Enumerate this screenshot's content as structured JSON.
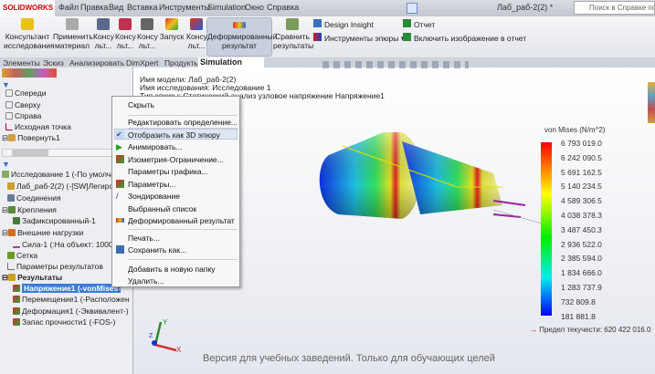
{
  "app": {
    "logo": "SOLIDWORKS",
    "doc_title": "Лаб_раб-2(2) *",
    "search_placeholder": "Поиск в Справке по S"
  },
  "menu": [
    "Файл",
    "Правка",
    "Вид",
    "Вставка",
    "Инструменты",
    "Simulation",
    "Окно",
    "Справка"
  ],
  "ribbon": {
    "buttons": [
      {
        "l1": "Консультант",
        "l2": "исследования"
      },
      {
        "l1": "Применить",
        "l2": "материал"
      },
      {
        "l1": "Консу",
        "l2": "льт..."
      },
      {
        "l1": "Консу",
        "l2": "льт..."
      },
      {
        "l1": "Консу",
        "l2": "льт..."
      },
      {
        "l1": "Запуск",
        "l2": ""
      },
      {
        "l1": "Консу",
        "l2": "льт..."
      },
      {
        "l1": "Деформированный",
        "l2": "результат"
      },
      {
        "l1": "Сравнить",
        "l2": "результаты"
      }
    ],
    "design_insight": "Design Insight",
    "plot_tools": "Инструменты эпюры",
    "report": "Отчет",
    "include_image": "Включить изображение в отчет"
  },
  "tabs": [
    "Элементы",
    "Эскиз",
    "Анализировать",
    "DimXpert",
    "Продукты Office",
    "Simulation"
  ],
  "tree_top": [
    "Спереди",
    "Сверху",
    "Справа",
    "Исходная точка",
    "Повернуть1"
  ],
  "tree": [
    "Исследование 1 (-По умолчанию-)",
    "Лаб_раб-2(2) (-[SW]Легированная сталь-)",
    "Соединения",
    "Крепления",
    "Зафиксированный-1",
    "Внешние нагрузки",
    "Сила-1 (:На объект: 1000 N:)",
    "Сетка",
    "Параметры результатов",
    "Результаты",
    "Напряжение1 (-vonMises-)",
    "Перемещение1 (-Расположение-)",
    "Деформация1 (-Эквивалент-)",
    "Запас прочности1 (-FOS-)"
  ],
  "context_menu": [
    "Скрыть",
    "Редактировать определение...",
    "Отобразить как 3D эпюру",
    "Анимировать...",
    "Изометрия-Ограничение...",
    "Параметры графика...",
    "Параметры...",
    "Зондирование",
    "Выбранный список",
    "Деформированный результат",
    "Печать...",
    "Сохранить как...",
    "Добавить в новую папку",
    "Удалить..."
  ],
  "info": {
    "model": "Имя модели: Лаб_раб-2(2)",
    "study": "Имя исследования: Исследование 1",
    "plot": "Тип эпюры: Статический анализ узловое напряжение Напряжение1"
  },
  "legend": {
    "title": "von Mises (N/m^2)",
    "values": [
      "6 793 019.0",
      "6 242 090.5",
      "5 691 162.5",
      "5 140 234.5",
      "4 589 306.5",
      "4 038 378.3",
      "3 487 450.3",
      "2 936 522.0",
      "2 385 594.0",
      "1 834 666.0",
      "1 283 737.9",
      "732 809.8",
      "181 881.8"
    ],
    "yield": "Предел текучести: 620 422 016.0"
  },
  "axes": {
    "x": "X",
    "y": "Y",
    "z": "Z"
  },
  "watermark": "Версия для учебных заведений. Только для обучающих целей"
}
